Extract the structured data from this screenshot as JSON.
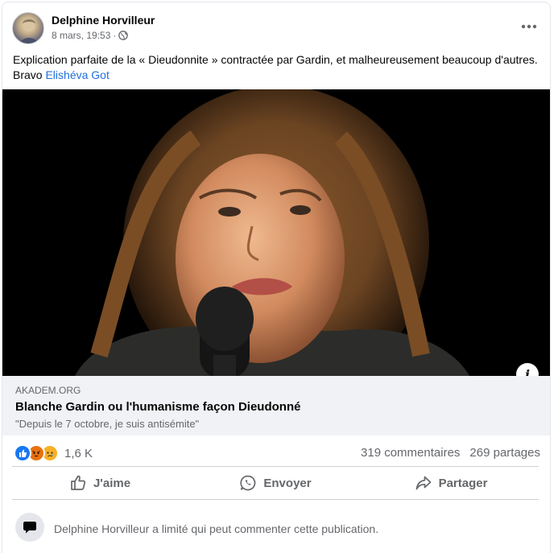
{
  "post": {
    "author": "Delphine Horvilleur",
    "timestamp": "8 mars, 19:53",
    "separator": "·",
    "audience_icon": "globe-icon",
    "menu_icon": "more-dots-icon",
    "caption_text": "Explication parfaite de la « Dieudonnite  » contractée par Gardin, et malheureusement beaucoup d'autres. Bravo ",
    "caption_mention": "Elishéva Got"
  },
  "link_preview": {
    "domain": "AKADEM.ORG",
    "title": "Blanche Gardin ou l'humanisme façon Dieudonné",
    "description": "\"Depuis le 7 octobre, je suis antisémite\"",
    "info_label": "i"
  },
  "stats": {
    "reactions": [
      "like",
      "angry",
      "sad"
    ],
    "reaction_count": "1,6 K",
    "comments": "319 commentaires",
    "shares": "269 partages"
  },
  "actions": {
    "like": "J'aime",
    "send": "Envoyer",
    "share": "Partager"
  },
  "comment_restriction": "Delphine Horvilleur a limité qui peut commenter cette publication.",
  "colors": {
    "accent_link": "#216fdb",
    "like_blue": "#1877f2",
    "angry_orange": "#e9710f",
    "sad_yellow": "#f7b125",
    "secondary_text": "#65676b"
  }
}
